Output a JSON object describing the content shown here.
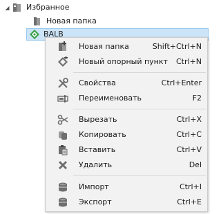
{
  "tree": {
    "root_label": "Избранное",
    "child_folder_label": "Новая папка",
    "selected_label": "BALB"
  },
  "context_menu": {
    "items": [
      {
        "label": "Новая папка",
        "shortcut": "Shift+Ctrl+N",
        "icon": "new-folder-icon"
      },
      {
        "label": "Новый опорный пункт",
        "shortcut": "Ctrl+N",
        "icon": "new-waypoint-icon"
      },
      {
        "label": "Свойства",
        "shortcut": "Ctrl+Enter",
        "icon": "properties-icon"
      },
      {
        "label": "Переименовать",
        "shortcut": "F2",
        "icon": "rename-icon"
      },
      {
        "label": "Вырезать",
        "shortcut": "Ctrl+X",
        "icon": "cut-icon"
      },
      {
        "label": "Копировать",
        "shortcut": "Ctrl+C",
        "icon": "copy-icon"
      },
      {
        "label": "Вставить",
        "shortcut": "Ctrl+V",
        "icon": "paste-icon"
      },
      {
        "label": "Удалить",
        "shortcut": "Del",
        "icon": "delete-icon"
      },
      {
        "label": "Импорт",
        "shortcut": "Ctrl+I",
        "icon": "import-icon"
      },
      {
        "label": "Экспорт",
        "shortcut": "Ctrl+E",
        "icon": "export-icon"
      }
    ]
  },
  "colors": {
    "selection_bg": "#cce4f7",
    "selection_border": "#99c9ef",
    "menu_bg": "#f2f2f2",
    "icon_gray": "#6e6e6e",
    "waypoint_green": "#3aa14a"
  }
}
